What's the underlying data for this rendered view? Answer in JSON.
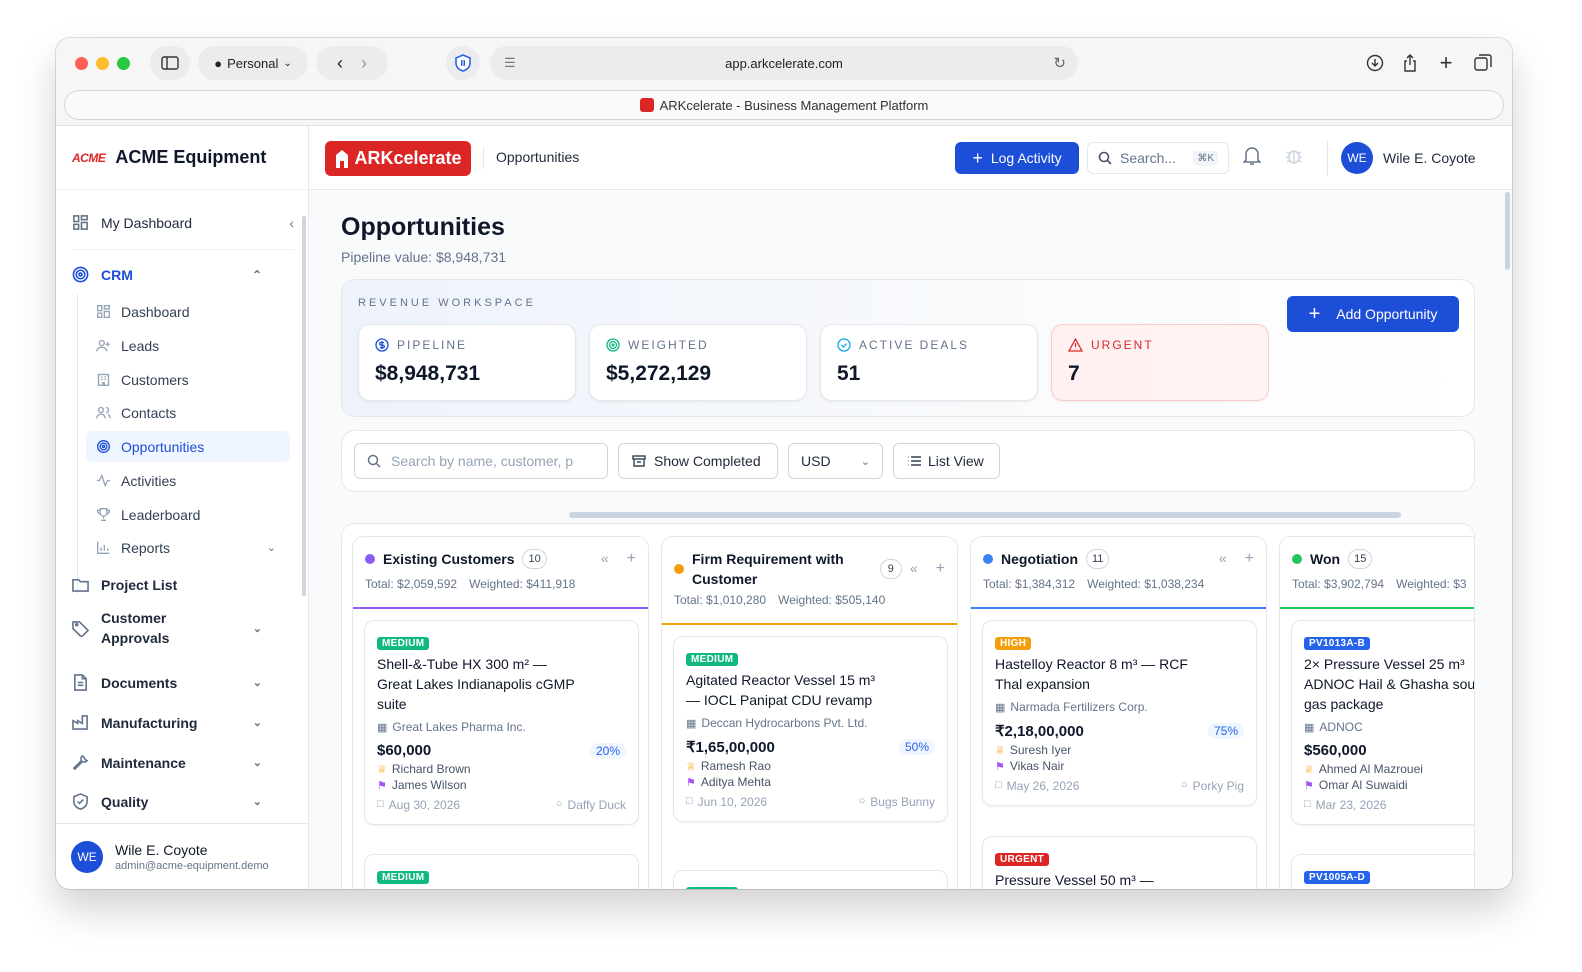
{
  "browser": {
    "profile": "Personal",
    "url": "app.arkcelerate.com",
    "tab_title": "ARKcelerate - Business Management Platform"
  },
  "sidebar": {
    "company_logo": "ACME",
    "company": "ACME Equipment",
    "my_dashboard": "My Dashboard",
    "crm": "CRM",
    "crm_items": [
      "Dashboard",
      "Leads",
      "Customers",
      "Contacts",
      "Opportunities",
      "Activities",
      "Leaderboard",
      "Reports"
    ],
    "sections": [
      "Project List",
      "Customer Approvals",
      "Documents",
      "Manufacturing",
      "Maintenance",
      "Quality"
    ],
    "user": {
      "initials": "WE",
      "name": "Wile E. Coyote",
      "email": "admin@acme-equipment.demo"
    }
  },
  "topbar": {
    "logo": "ARKcelerate",
    "breadcrumb": "Opportunities",
    "log_activity": "Log Activity",
    "search_placeholder": "Search...",
    "search_shortcut": "⌘K",
    "user_initials": "WE",
    "user_name": "Wile E. Coyote"
  },
  "page": {
    "title": "Opportunities",
    "pipeline_value": "Pipeline value: $8,948,731",
    "workspace_label": "REVENUE WORKSPACE",
    "add_button": "Add Opportunity"
  },
  "kpis": [
    {
      "label": "PIPELINE",
      "value": "$8,948,731"
    },
    {
      "label": "WEIGHTED",
      "value": "$5,272,129"
    },
    {
      "label": "ACTIVE DEALS",
      "value": "51"
    },
    {
      "label": "URGENT",
      "value": "7"
    }
  ],
  "filters": {
    "search_placeholder": "Search by name, customer, p",
    "show_completed": "Show Completed",
    "currency": "USD",
    "view": "List View"
  },
  "colors": {
    "accent": "#1d4ed8",
    "brand": "#dc2626",
    "urgent": "#dc2626",
    "medium": "#10b981",
    "high": "#f59e0b"
  },
  "columns": [
    {
      "title": "Existing Customers",
      "count": "10",
      "color": "#8b5cf6",
      "total": "Total: $2,059,592",
      "weighted": "Weighted: $411,918",
      "deals": [
        {
          "badge": "MEDIUM",
          "title": "Shell-&-Tube HX 300 m² — Great Lakes Indianapolis cGMP suite",
          "customer": "Great Lakes Pharma Inc.",
          "value": "$60,000",
          "pct": "20%",
          "owner": "Richard Brown",
          "contact": "James Wilson",
          "date": "Aug 30, 2026",
          "assignee": "Daffy Duck"
        },
        {
          "badge": "MEDIUM"
        }
      ]
    },
    {
      "title": "Firm Requirement with Customer",
      "count": "9",
      "color": "#f59e0b",
      "total": "Total: $1,010,280",
      "weighted": "Weighted: $505,140",
      "deals": [
        {
          "badge": "MEDIUM",
          "title": "Agitated Reactor Vessel 15 m³ — IOCL Panipat CDU revamp",
          "customer": "Deccan Hydrocarbons Pvt. Ltd.",
          "value": "₹1,65,00,000",
          "pct": "50%",
          "owner": "Ramesh Rao",
          "contact": "Aditya Mehta",
          "date": "Jun 10, 2026",
          "assignee": "Bugs Bunny"
        },
        {
          "badge": "MEDIUM"
        }
      ]
    },
    {
      "title": "Negotiation",
      "count": "11",
      "color": "#3b82f6",
      "total": "Total: $1,384,312",
      "weighted": "Weighted: $1,038,234",
      "deals": [
        {
          "badge": "HIGH",
          "title": "Hastelloy Reactor 8 m³ — RCF Thal expansion",
          "customer": "Narmada Fertilizers Corp.",
          "value": "₹2,18,00,000",
          "pct": "75%",
          "owner": "Suresh Iyer",
          "contact": "Vikas Nair",
          "date": "May 26, 2026",
          "assignee": "Porky Pig"
        },
        {
          "badge": "URGENT",
          "title": "Pressure Vessel 50 m³ —"
        }
      ]
    },
    {
      "title": "Won",
      "count": "15",
      "color": "#22c55e",
      "total": "Total: $3,902,794",
      "weighted": "Weighted: $3",
      "deals": [
        {
          "badge": "PV1013A-B",
          "title": "2× Pressure Vessel 25 m³ ADNOC Hail & Ghasha sou gas package",
          "customer": "ADNOC",
          "value": "$560,000",
          "pct": "",
          "owner": "Ahmed Al Mazrouei",
          "contact": "Omar Al Suwaidi",
          "date": "Mar 23, 2026",
          "assignee": ""
        },
        {
          "badge": "PV1005A-D"
        }
      ]
    }
  ]
}
